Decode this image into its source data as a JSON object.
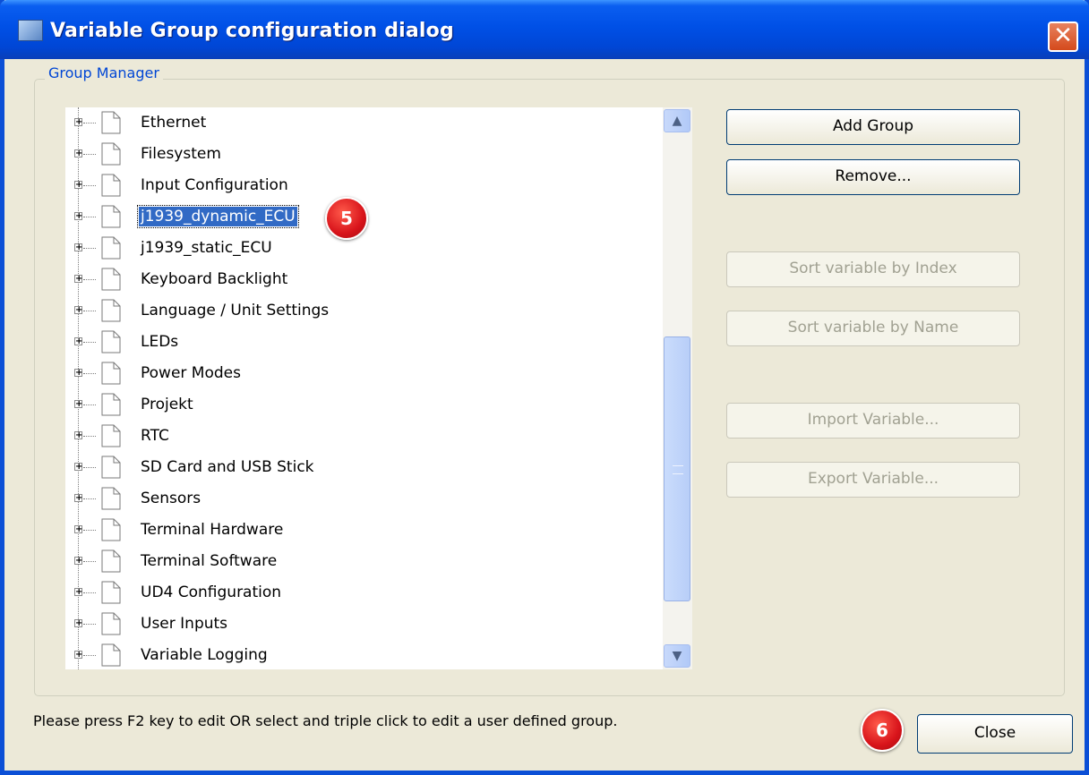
{
  "window": {
    "title": "Variable Group configuration dialog",
    "close_glyph": "✕"
  },
  "group_manager": {
    "legend": "Group Manager",
    "tree": {
      "items": [
        {
          "label": "Ethernet",
          "selected": false
        },
        {
          "label": "Filesystem",
          "selected": false
        },
        {
          "label": "Input Configuration",
          "selected": false
        },
        {
          "label": "j1939_dynamic_ECU",
          "selected": true
        },
        {
          "label": "j1939_static_ECU",
          "selected": false
        },
        {
          "label": "Keyboard Backlight",
          "selected": false
        },
        {
          "label": "Language / Unit Settings",
          "selected": false
        },
        {
          "label": "LEDs",
          "selected": false
        },
        {
          "label": "Power Modes",
          "selected": false
        },
        {
          "label": "Projekt",
          "selected": false
        },
        {
          "label": "RTC",
          "selected": false
        },
        {
          "label": "SD Card and USB Stick",
          "selected": false
        },
        {
          "label": "Sensors",
          "selected": false
        },
        {
          "label": "Terminal Hardware",
          "selected": false
        },
        {
          "label": "Terminal Software",
          "selected": false
        },
        {
          "label": "UD4 Configuration",
          "selected": false
        },
        {
          "label": "User Inputs",
          "selected": false
        },
        {
          "label": "Variable Logging",
          "selected": false
        }
      ],
      "scroll_position_fraction": 0.55
    },
    "buttons": {
      "add_group": "Add Group",
      "remove": "Remove...",
      "sort_index": "Sort variable by Index",
      "sort_name": "Sort variable by Name",
      "import": "Import Variable...",
      "export": "Export Variable..."
    }
  },
  "status": {
    "hint": "Please press F2 key to edit OR select and triple click to edit a user defined group."
  },
  "footer": {
    "close_label": "Close"
  },
  "annotations": {
    "badge_5": "5",
    "badge_6": "6",
    "badge_color": "#d8141b"
  },
  "colors": {
    "titlebar": "#0050e6",
    "selection": "#316ac5",
    "legend_text": "#0046d5",
    "dialog_bg": "#ece9d8"
  }
}
